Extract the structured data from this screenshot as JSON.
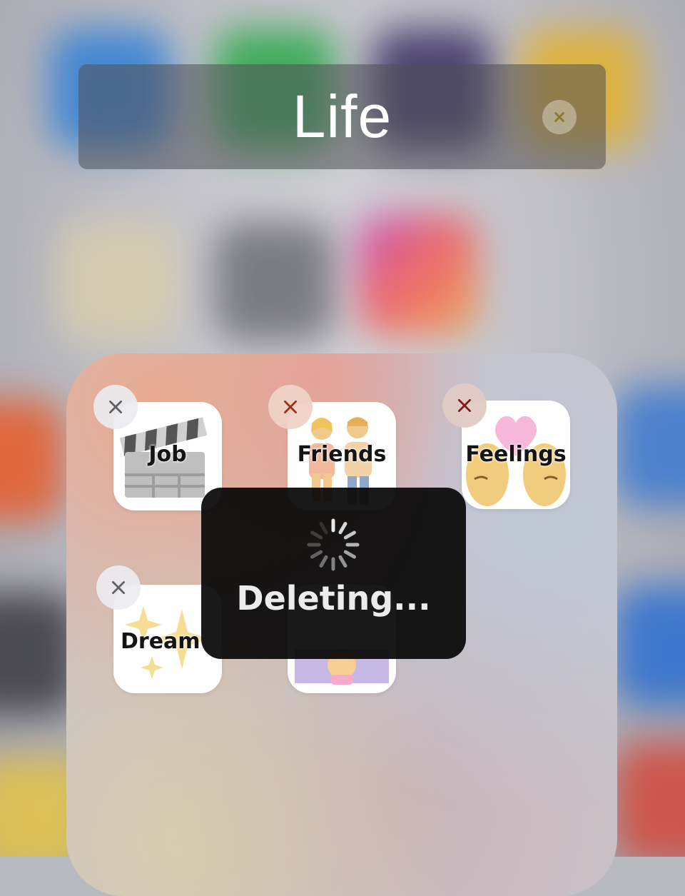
{
  "folder": {
    "title": "Life",
    "apps": [
      {
        "label": "Job",
        "icon": "clapper-board-icon"
      },
      {
        "label": "Friends",
        "icon": "two-people-icon"
      },
      {
        "label": "Feelings",
        "icon": "heart-faces-icon"
      },
      {
        "label": "Dream",
        "icon": "sparkles-icon"
      },
      {
        "label": "",
        "icon": "girl-face-icon"
      }
    ]
  },
  "hud": {
    "message": "Deleting..."
  },
  "colors": {
    "badge_x_gray": "#5f6368",
    "badge_x_red": "#9a3412",
    "badge_x_darkred": "#7f1d1d",
    "hud_bg": "#080808"
  }
}
